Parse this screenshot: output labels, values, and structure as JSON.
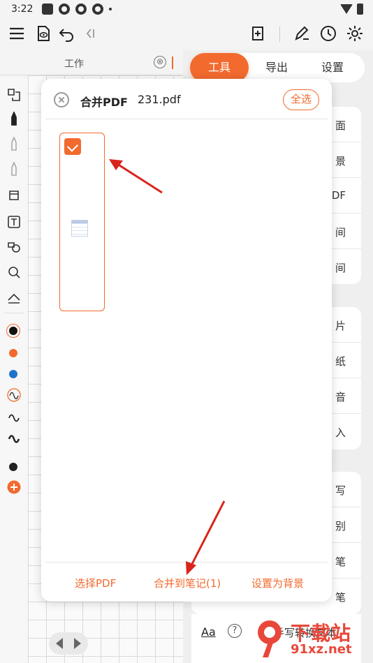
{
  "status_bar": {
    "time": "3:22"
  },
  "tab": {
    "label": "工作",
    "close_glyph": "⊗"
  },
  "right_panel": {
    "tabs": [
      "工具",
      "导出",
      "设置"
    ],
    "group1": [
      "面",
      "景",
      "DF",
      "间",
      "间"
    ],
    "group2": [
      "片",
      "纸",
      "音",
      "入"
    ],
    "group3": [
      "写",
      "别",
      "笔",
      "笔"
    ],
    "bottom_item": {
      "icon_text": "Aa",
      "help_glyph": "?",
      "label": "手写转换文本"
    }
  },
  "dialog": {
    "title": "合并PDF",
    "file_name": "231.pdf",
    "select_all": "全选",
    "buttons": {
      "choose": "选择PDF",
      "merge": "合并到笔记(1)",
      "background": "设置为背景"
    }
  },
  "watermark": {
    "big": "下载站",
    "small": "91xz.net"
  },
  "colors": {
    "accent": "#f26a2e",
    "arrow": "#d9241c",
    "watermark": "#e8473a"
  }
}
